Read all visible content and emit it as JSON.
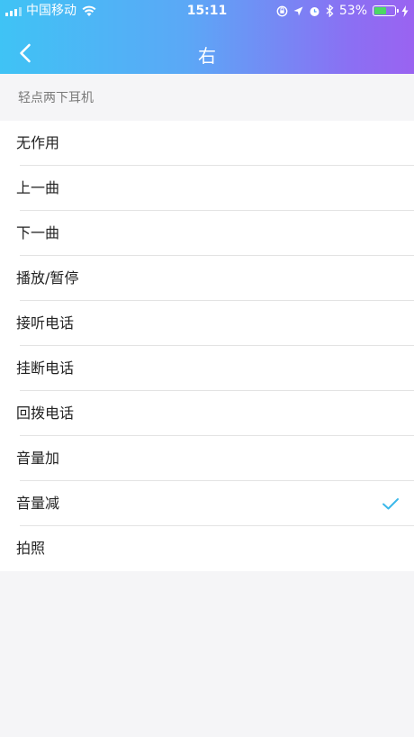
{
  "status_bar": {
    "carrier": "中国移动",
    "time": "15:11",
    "battery": "53%",
    "battery_level": 0.53
  },
  "nav": {
    "title": "右",
    "back_icon": "chevron-left-icon"
  },
  "section": {
    "header": "轻点两下耳机"
  },
  "options": [
    {
      "label": "无作用",
      "selected": false
    },
    {
      "label": "上一曲",
      "selected": false
    },
    {
      "label": "下一曲",
      "selected": false
    },
    {
      "label": "播放/暂停",
      "selected": false
    },
    {
      "label": "接听电话",
      "selected": false
    },
    {
      "label": "挂断电话",
      "selected": false
    },
    {
      "label": "回拨电话",
      "selected": false
    },
    {
      "label": "音量加",
      "selected": false
    },
    {
      "label": "音量减",
      "selected": true
    },
    {
      "label": "拍照",
      "selected": false
    }
  ],
  "colors": {
    "gradient_start": "#3fc3f5",
    "gradient_end": "#9a63f1",
    "check": "#3bb8ea",
    "battery_fill": "#4cd964"
  }
}
